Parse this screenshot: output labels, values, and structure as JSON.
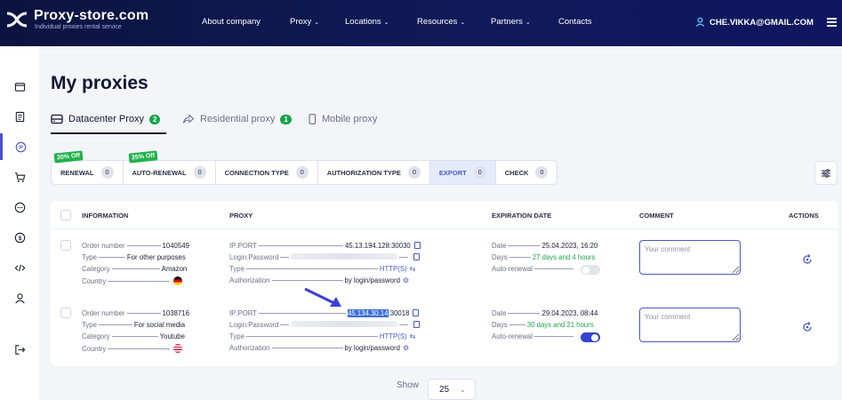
{
  "brand": {
    "name": "Proxy-store.com",
    "tagline": "Individual proxies rental service"
  },
  "nav": {
    "items": [
      {
        "label": "About company",
        "has_dropdown": false
      },
      {
        "label": "Proxy",
        "has_dropdown": true
      },
      {
        "label": "Locations",
        "has_dropdown": true
      },
      {
        "label": "Resources",
        "has_dropdown": true
      },
      {
        "label": "Partners",
        "has_dropdown": true
      },
      {
        "label": "Contacts",
        "has_dropdown": false
      }
    ],
    "user_email": "CHE.VIKKA@GMAIL.COM"
  },
  "sidebar": {
    "items": [
      {
        "icon": "wallet-icon"
      },
      {
        "icon": "document-icon"
      },
      {
        "icon": "ip-icon",
        "active": true
      },
      {
        "icon": "cart-icon"
      },
      {
        "icon": "chat-icon"
      },
      {
        "icon": "dollar-icon"
      },
      {
        "icon": "code-icon"
      },
      {
        "icon": "user-icon"
      },
      {
        "icon": "logout-icon"
      }
    ]
  },
  "page": {
    "title": "My proxies"
  },
  "tabs": [
    {
      "label": "Datacenter Proxy",
      "count": "2",
      "active": true
    },
    {
      "label": "Residential proxy",
      "count": "1"
    },
    {
      "label": "Mobile proxy",
      "count": ""
    }
  ],
  "filters": [
    {
      "label": "RENEWAL",
      "count": "0",
      "promo": "20% Off"
    },
    {
      "label": "AUTO-RENEWAL",
      "count": "0",
      "promo": "25% Off"
    },
    {
      "label": "CONNECTION TYPE",
      "count": "0"
    },
    {
      "label": "AUTHORIZATION TYPE",
      "count": "0"
    },
    {
      "label": "EXPORT",
      "count": "0",
      "active": true
    },
    {
      "label": "CHECK",
      "count": "0"
    }
  ],
  "table": {
    "columns": [
      "INFORMATION",
      "PROXY",
      "EXPIRATION DATE",
      "COMMENT",
      "ACTIONS"
    ],
    "labels": {
      "order": "Order number",
      "type": "Type",
      "category": "Category",
      "country": "Country",
      "ipport": "IP:PORT",
      "login": "Login:Password",
      "ptype": "Type",
      "auth": "Authorization",
      "date": "Date",
      "days": "Days",
      "autorenew": "Auto-renewal"
    },
    "rows": [
      {
        "order_number": "1040549",
        "type": "For other purposes",
        "category": "Amazon",
        "country_flag": "germany-flag-icon",
        "ip": "",
        "ip_rest": "45.13.194.128:30030",
        "proxy_type": "HTTP(S)",
        "authorization": "by login/password",
        "date": "25.04.2023, 16:20",
        "days": "27 days and 4 hours",
        "auto_renewal": false,
        "comment_placeholder": "Your comment"
      },
      {
        "order_number": "1038716",
        "type": "For social media",
        "category": "Youtube",
        "country_flag": "usa-flag-icon",
        "ip": "45.134.30.14",
        "ip_rest": ":30018",
        "proxy_type": "HTTP(S)",
        "authorization": "by login/password",
        "date": "29.04.2023, 08:44",
        "days": "30 days and 21 hours",
        "auto_renewal": true,
        "comment_placeholder": "Your comment"
      }
    ]
  },
  "pagination": {
    "show_label": "Show",
    "page_size": "25"
  },
  "colors": {
    "accent": "#4a58c7",
    "green": "#1fa64a",
    "topbar": "#0b1440"
  }
}
